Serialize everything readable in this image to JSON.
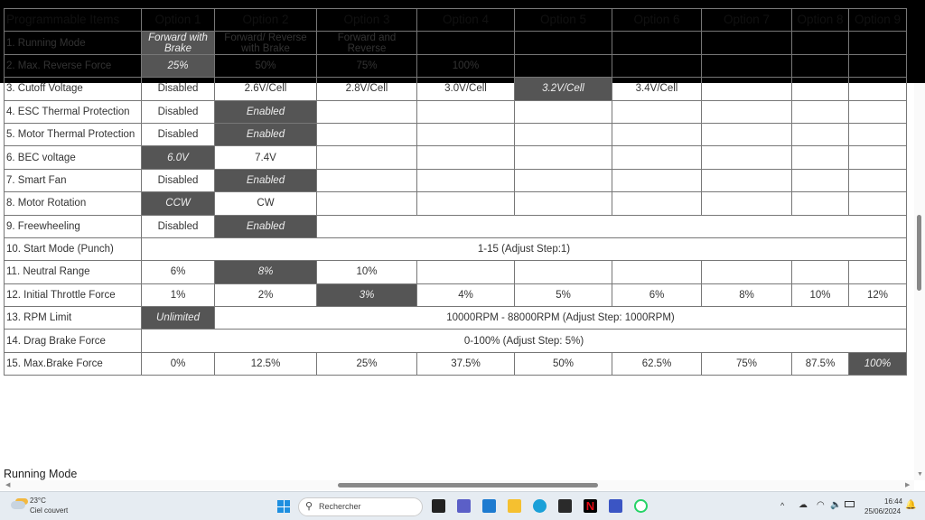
{
  "table": {
    "headers": [
      "Programmable Items",
      "Option 1",
      "Option 2",
      "Option 3",
      "Option 4",
      "Option 5",
      "Option 6",
      "Option 7",
      "Option 8",
      "Option 9"
    ],
    "rows": [
      {
        "item": "1. Running Mode",
        "cells": [
          {
            "t": "Forward with Brake",
            "hl": true
          },
          {
            "t": "Forward/ Reverse with Brake"
          },
          {
            "t": "Forward and Reverse"
          },
          {
            "t": ""
          },
          {
            "t": ""
          },
          {
            "t": ""
          },
          {
            "t": ""
          },
          {
            "t": ""
          },
          {
            "t": ""
          }
        ]
      },
      {
        "item": "2. Max. Reverse Force",
        "cells": [
          {
            "t": "25%",
            "hl": true
          },
          {
            "t": "50%"
          },
          {
            "t": "75%"
          },
          {
            "t": "100%"
          },
          {
            "t": ""
          },
          {
            "t": ""
          },
          {
            "t": ""
          },
          {
            "t": ""
          },
          {
            "t": ""
          }
        ]
      },
      {
        "item": "3. Cutoff Voltage",
        "cells": [
          {
            "t": "Disabled"
          },
          {
            "t": "2.6V/Cell"
          },
          {
            "t": "2.8V/Cell"
          },
          {
            "t": "3.0V/Cell"
          },
          {
            "t": "3.2V/Cell",
            "hl": true
          },
          {
            "t": "3.4V/Cell"
          },
          {
            "t": ""
          },
          {
            "t": ""
          },
          {
            "t": ""
          }
        ]
      },
      {
        "item": "4. ESC Thermal Protection",
        "cells": [
          {
            "t": "Disabled"
          },
          {
            "t": "Enabled",
            "hl": true
          },
          {
            "t": ""
          },
          {
            "t": ""
          },
          {
            "t": ""
          },
          {
            "t": ""
          },
          {
            "t": ""
          },
          {
            "t": ""
          },
          {
            "t": ""
          }
        ]
      },
      {
        "item": "5. Motor Thermal Protection",
        "cells": [
          {
            "t": "Disabled"
          },
          {
            "t": "Enabled",
            "hl": true
          },
          {
            "t": ""
          },
          {
            "t": ""
          },
          {
            "t": ""
          },
          {
            "t": ""
          },
          {
            "t": ""
          },
          {
            "t": ""
          },
          {
            "t": ""
          }
        ]
      },
      {
        "item": "6. BEC voltage",
        "cells": [
          {
            "t": "6.0V",
            "hl": true
          },
          {
            "t": "7.4V"
          },
          {
            "t": ""
          },
          {
            "t": ""
          },
          {
            "t": ""
          },
          {
            "t": ""
          },
          {
            "t": ""
          },
          {
            "t": ""
          },
          {
            "t": ""
          }
        ]
      },
      {
        "item": "7. Smart Fan",
        "cells": [
          {
            "t": "Disabled"
          },
          {
            "t": "Enabled",
            "hl": true
          },
          {
            "t": ""
          },
          {
            "t": ""
          },
          {
            "t": ""
          },
          {
            "t": ""
          },
          {
            "t": ""
          },
          {
            "t": ""
          },
          {
            "t": ""
          }
        ]
      },
      {
        "item": "8. Motor Rotation",
        "cells": [
          {
            "t": "CCW",
            "hl": true
          },
          {
            "t": "CW"
          },
          {
            "t": ""
          },
          {
            "t": ""
          },
          {
            "t": ""
          },
          {
            "t": ""
          },
          {
            "t": ""
          },
          {
            "t": ""
          },
          {
            "t": ""
          }
        ]
      },
      {
        "item": "9. Freewheeling",
        "cells": [
          {
            "t": "Disabled"
          },
          {
            "t": "Enabled",
            "hl": true
          },
          {
            "t": "",
            "span": 7
          }
        ]
      },
      {
        "item": "10. Start Mode (Punch)",
        "cells": [
          {
            "t": "1-15 (Adjust Step:1)",
            "span": 9
          }
        ]
      },
      {
        "item": "11. Neutral Range",
        "cells": [
          {
            "t": "6%"
          },
          {
            "t": "8%",
            "hl": true
          },
          {
            "t": "10%"
          },
          {
            "t": ""
          },
          {
            "t": ""
          },
          {
            "t": ""
          },
          {
            "t": ""
          },
          {
            "t": ""
          },
          {
            "t": ""
          }
        ]
      },
      {
        "item": "12. Initial Throttle Force",
        "cells": [
          {
            "t": "1%"
          },
          {
            "t": "2%"
          },
          {
            "t": "3%",
            "hl": true
          },
          {
            "t": "4%"
          },
          {
            "t": "5%"
          },
          {
            "t": "6%"
          },
          {
            "t": "8%"
          },
          {
            "t": "10%"
          },
          {
            "t": "12%"
          }
        ]
      },
      {
        "item": "13. RPM Limit",
        "cells": [
          {
            "t": "Unlimited",
            "hl": true
          },
          {
            "t": "10000RPM - 88000RPM (Adjust Step: 1000RPM)",
            "span": 8
          }
        ]
      },
      {
        "item": "14. Drag Brake Force",
        "cells": [
          {
            "t": "0-100% (Adjust Step: 5%)",
            "span": 9
          }
        ]
      },
      {
        "item": "15. Max.Brake Force",
        "cells": [
          {
            "t": "0%"
          },
          {
            "t": "12.5%"
          },
          {
            "t": "25%"
          },
          {
            "t": "37.5%"
          },
          {
            "t": "50%"
          },
          {
            "t": "62.5%"
          },
          {
            "t": "75%"
          },
          {
            "t": "87.5%"
          },
          {
            "t": "100%",
            "hl": true
          }
        ]
      }
    ]
  },
  "section_heading": "Running Mode",
  "taskbar": {
    "temp": "23°C",
    "weather": "Ciel couvert",
    "search_placeholder": "Rechercher",
    "time": "16:44",
    "date": "25/06/2024"
  },
  "colors": {
    "highlight": "#555555"
  }
}
